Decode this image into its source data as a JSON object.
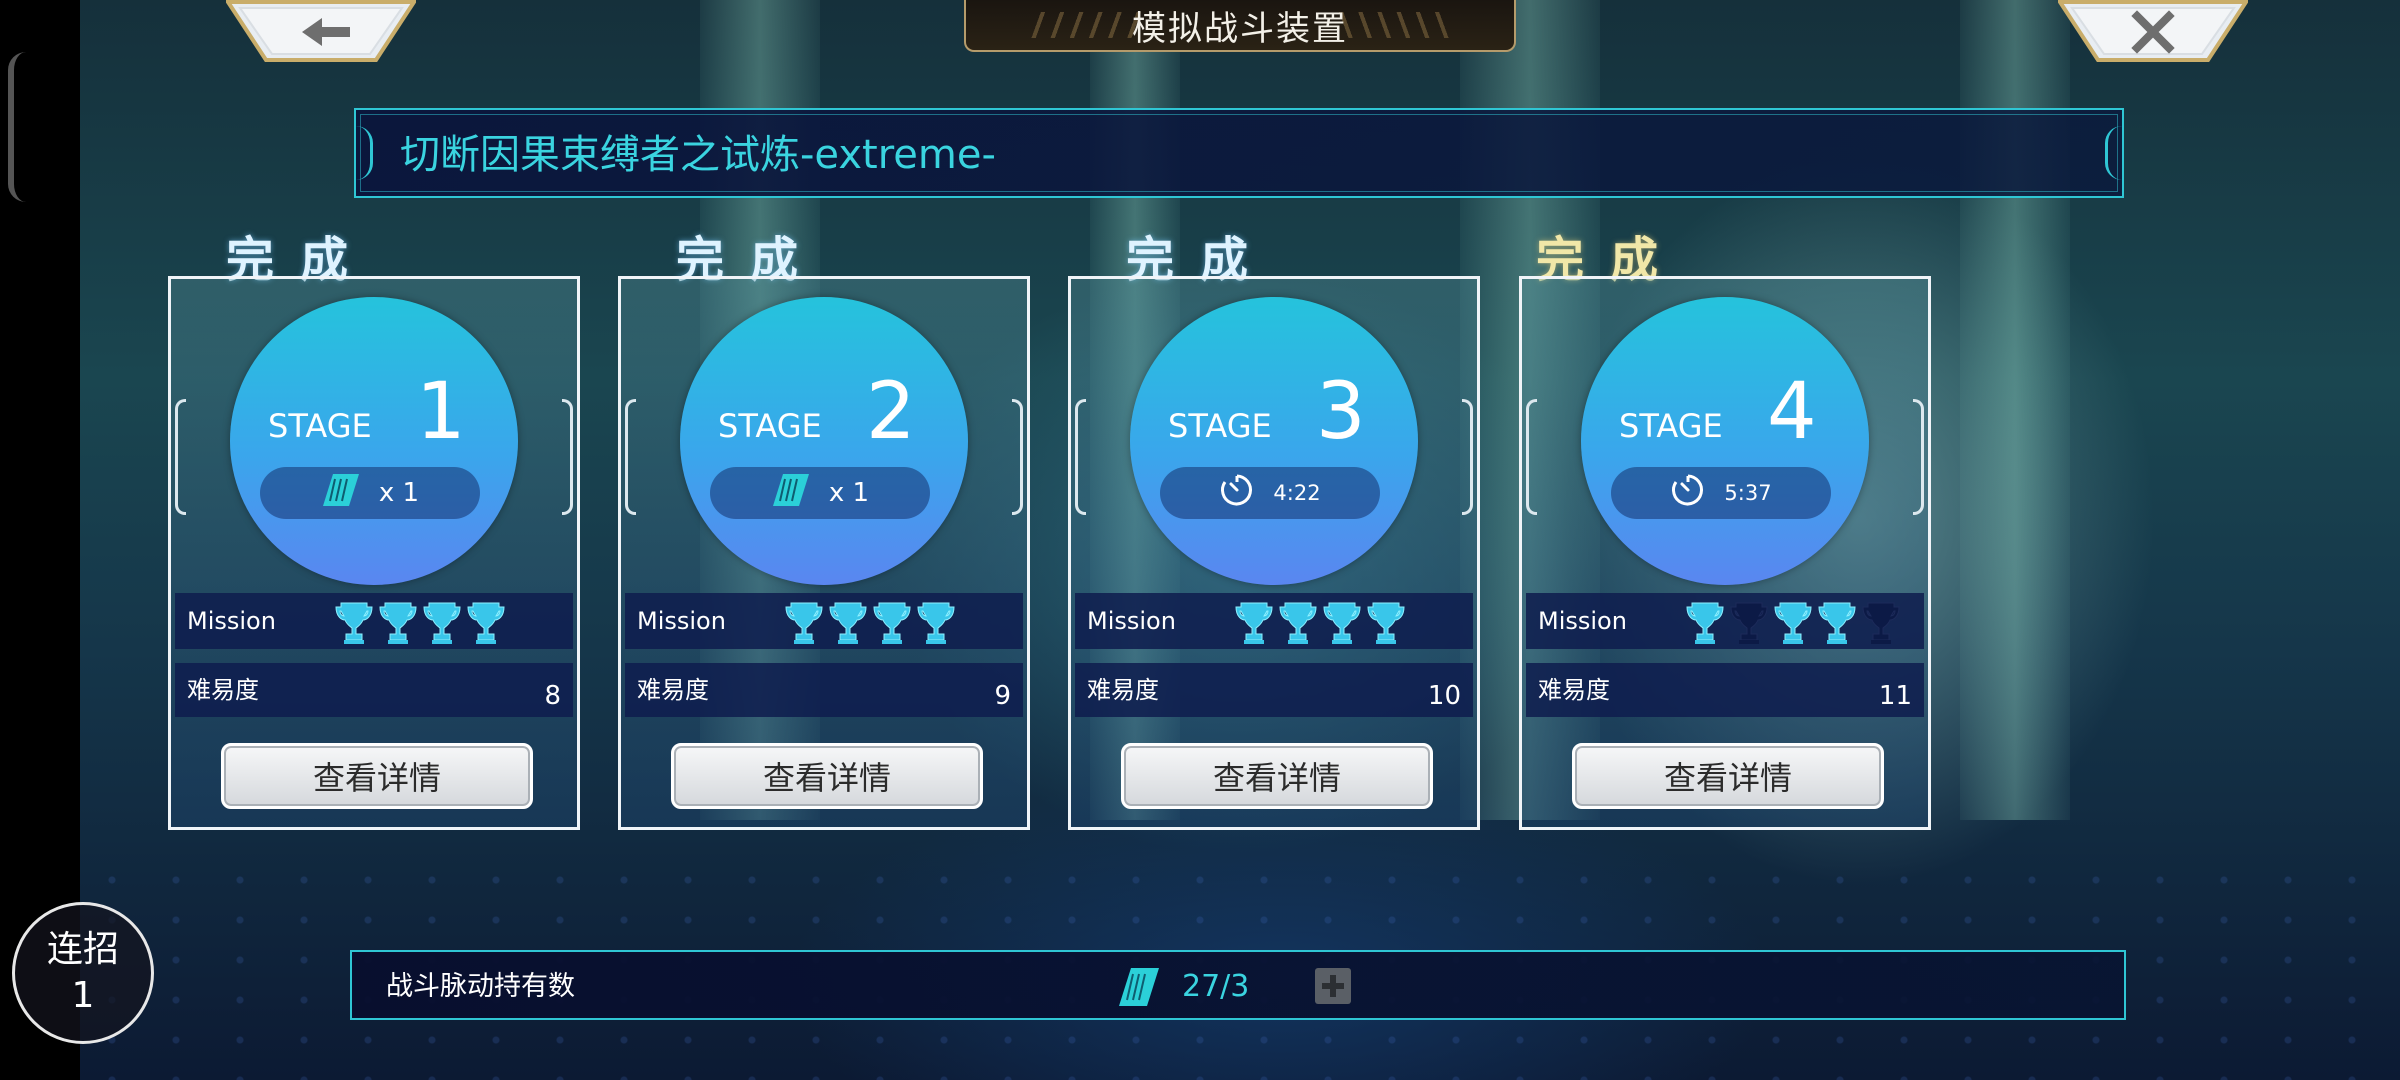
{
  "header": {
    "title": "模拟战斗装置",
    "back_icon": "back-arrow-icon",
    "close_icon": "close-icon"
  },
  "quest": {
    "title": "切断因果束缚者之试炼-extreme-"
  },
  "stages": [
    {
      "status": "完成",
      "stage_label": "STAGE",
      "number": "1",
      "pill_type": "ticket",
      "pill_text": "x 1",
      "mission_label": "Mission",
      "trophies_earned": 4,
      "trophies_total": 4,
      "difficulty_label": "难易度",
      "difficulty": "8",
      "detail_label": "查看详情"
    },
    {
      "status": "完成",
      "stage_label": "STAGE",
      "number": "2",
      "pill_type": "ticket",
      "pill_text": "x 1",
      "mission_label": "Mission",
      "trophies_earned": 4,
      "trophies_total": 4,
      "difficulty_label": "难易度",
      "difficulty": "9",
      "detail_label": "查看详情"
    },
    {
      "status": "完成",
      "stage_label": "STAGE",
      "number": "3",
      "pill_type": "timer",
      "pill_text": "4:22",
      "mission_label": "Mission",
      "trophies_earned": 4,
      "trophies_total": 4,
      "difficulty_label": "难易度",
      "difficulty": "10",
      "detail_label": "查看详情"
    },
    {
      "status": "完成",
      "stage_label": "STAGE",
      "number": "4",
      "pill_type": "timer",
      "pill_text": "5:37",
      "mission_label": "Mission",
      "trophies_earned": 3,
      "trophies_total": 5,
      "trophy_pattern": [
        1,
        0,
        1,
        1,
        0
      ],
      "difficulty_label": "难易度",
      "difficulty": "11",
      "detail_label": "查看详情"
    }
  ],
  "footer": {
    "label": "战斗脉动持有数",
    "count": "27/3",
    "plus_icon": "plus-icon"
  },
  "combo": {
    "label": "连招",
    "value": "1"
  },
  "colors": {
    "accent": "#2fc6d4",
    "trophy_on": "#39c6ea",
    "trophy_off": "#0c1a46",
    "done_gold": "#f1e7a8"
  }
}
